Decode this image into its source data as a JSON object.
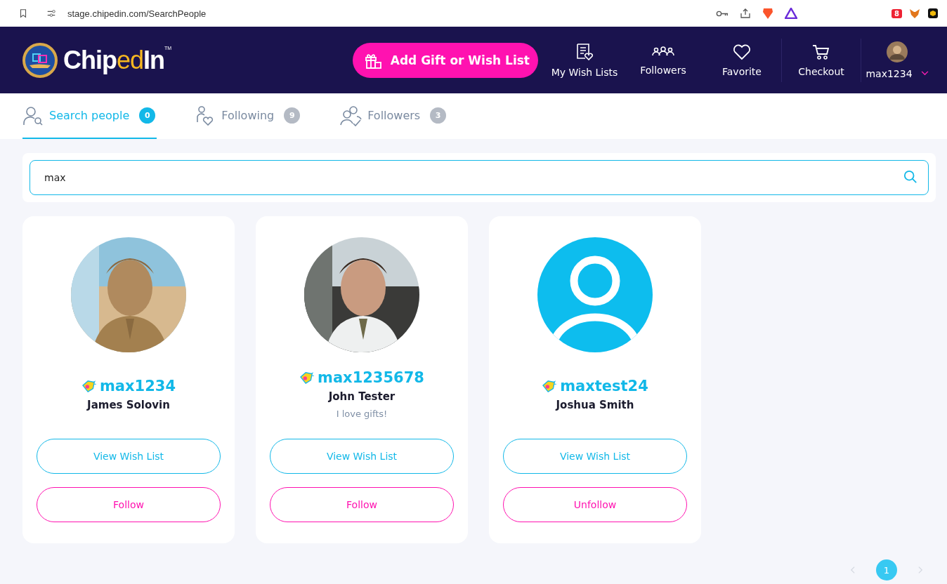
{
  "browser": {
    "url": "stage.chipedin.com/SearchPeople",
    "extension_badge": "8"
  },
  "header": {
    "logo": {
      "prefix": "Chip",
      "accent": "ed",
      "suffix": "In",
      "mark": "TM"
    },
    "cta": "Add Gift or Wish List",
    "nav": [
      {
        "label": "My Wish Lists",
        "kind": "wishlist"
      },
      {
        "label": "Followers",
        "kind": "followers"
      },
      {
        "label": "Favorite",
        "kind": "heart"
      },
      {
        "label": "Checkout",
        "kind": "cart"
      }
    ],
    "user": "max1234"
  },
  "tabs": [
    {
      "label": "Search people",
      "count": "0",
      "selected": true,
      "kind": "search"
    },
    {
      "label": "Following",
      "count": "9",
      "selected": false,
      "kind": "heart"
    },
    {
      "label": "Followers",
      "count": "3",
      "selected": false,
      "kind": "people"
    }
  ],
  "search": {
    "value": "max"
  },
  "people": [
    {
      "username": "max1234",
      "name": "James Solovin",
      "kind": "picture",
      "actions": [
        "View Wish List",
        "Follow"
      ]
    },
    {
      "username": "max1235678",
      "name": "John Tester",
      "bio": "I love gifts!",
      "kind": "picture",
      "actions": [
        "View Wish List",
        "Follow"
      ]
    },
    {
      "username": "maxtest24",
      "name": "Joshua Smith",
      "kind": "default",
      "actions": [
        "View Wish List",
        "Unfollow"
      ]
    }
  ],
  "pagination": [
    {
      "label": "1",
      "selected": true
    }
  ]
}
